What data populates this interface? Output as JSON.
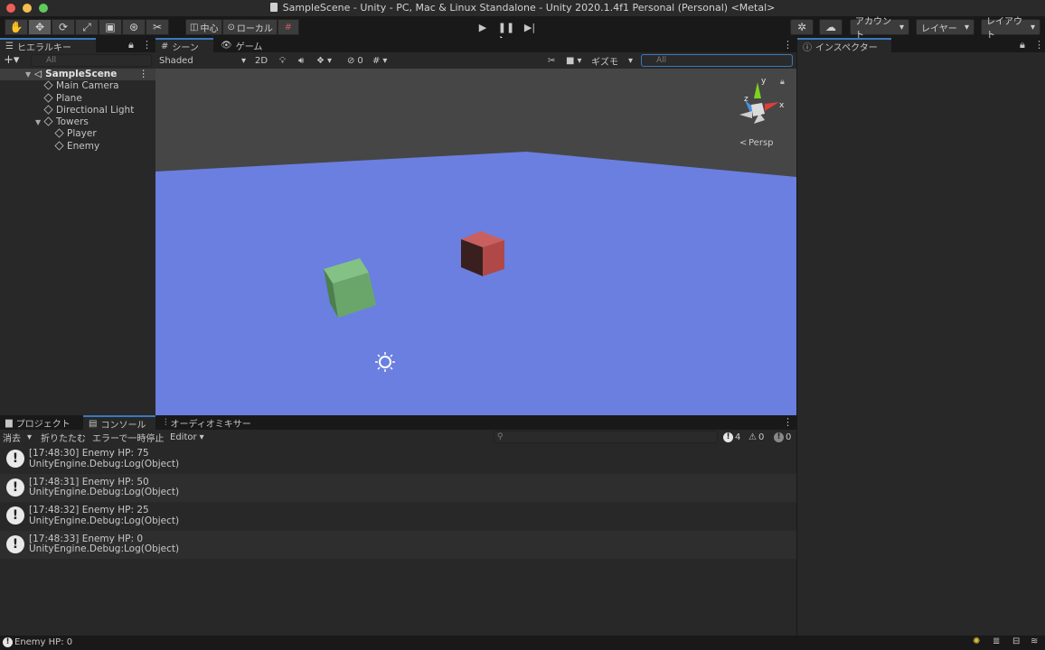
{
  "window": {
    "title": "SampleScene - Unity - PC, Mac & Linux Standalone - Unity 2020.1.4f1 Personal (Personal) <Metal>"
  },
  "toolbar": {
    "pivot_label": "中心",
    "space_label": "ローカル",
    "account_label": "アカウント",
    "layers_label": "レイヤー",
    "layout_label": "レイアウト"
  },
  "hierarchy": {
    "tab_label": "ヒエラルキー",
    "search_placeholder": "All",
    "scene_name": "SampleScene",
    "items": [
      {
        "label": "Main Camera"
      },
      {
        "label": "Plane"
      },
      {
        "label": "Directional Light"
      },
      {
        "label": "Towers"
      },
      {
        "label": "Player"
      },
      {
        "label": "Enemy"
      }
    ]
  },
  "scene": {
    "tab_scene": "シーン",
    "tab_game": "ゲーム",
    "shading_mode": "Shaded",
    "mode_2d": "2D",
    "hidden_count": "0",
    "gizmos_label": "ギズモ",
    "search_placeholder": "All",
    "persp_label": "Persp",
    "axis_y": "y",
    "axis_x": "x",
    "axis_z": "z",
    "plane_color": "#6a7fe0",
    "player_color": "#6aa66a",
    "enemy_color": "#b04848"
  },
  "inspector": {
    "tab_label": "インスペクター"
  },
  "bottom": {
    "tab_project": "プロジェクト",
    "tab_console": "コンソール",
    "tab_audio": "オーディオミキサー",
    "clear_label": "消去",
    "collapse_label": "折りたたむ",
    "error_pause_label": "エラーで一時停止",
    "editor_label": "Editor",
    "info_count": "4",
    "warning_count": "0",
    "error_count": "0",
    "logs": [
      {
        "line1": "[17:48:30] Enemy HP: 75",
        "line2": "UnityEngine.Debug:Log(Object)"
      },
      {
        "line1": "[17:48:31] Enemy HP: 50",
        "line2": "UnityEngine.Debug:Log(Object)"
      },
      {
        "line1": "[17:48:32] Enemy HP: 25",
        "line2": "UnityEngine.Debug:Log(Object)"
      },
      {
        "line1": "[17:48:33] Enemy HP: 0",
        "line2": "UnityEngine.Debug:Log(Object)"
      }
    ]
  },
  "statusbar": {
    "message": "Enemy HP: 0"
  }
}
